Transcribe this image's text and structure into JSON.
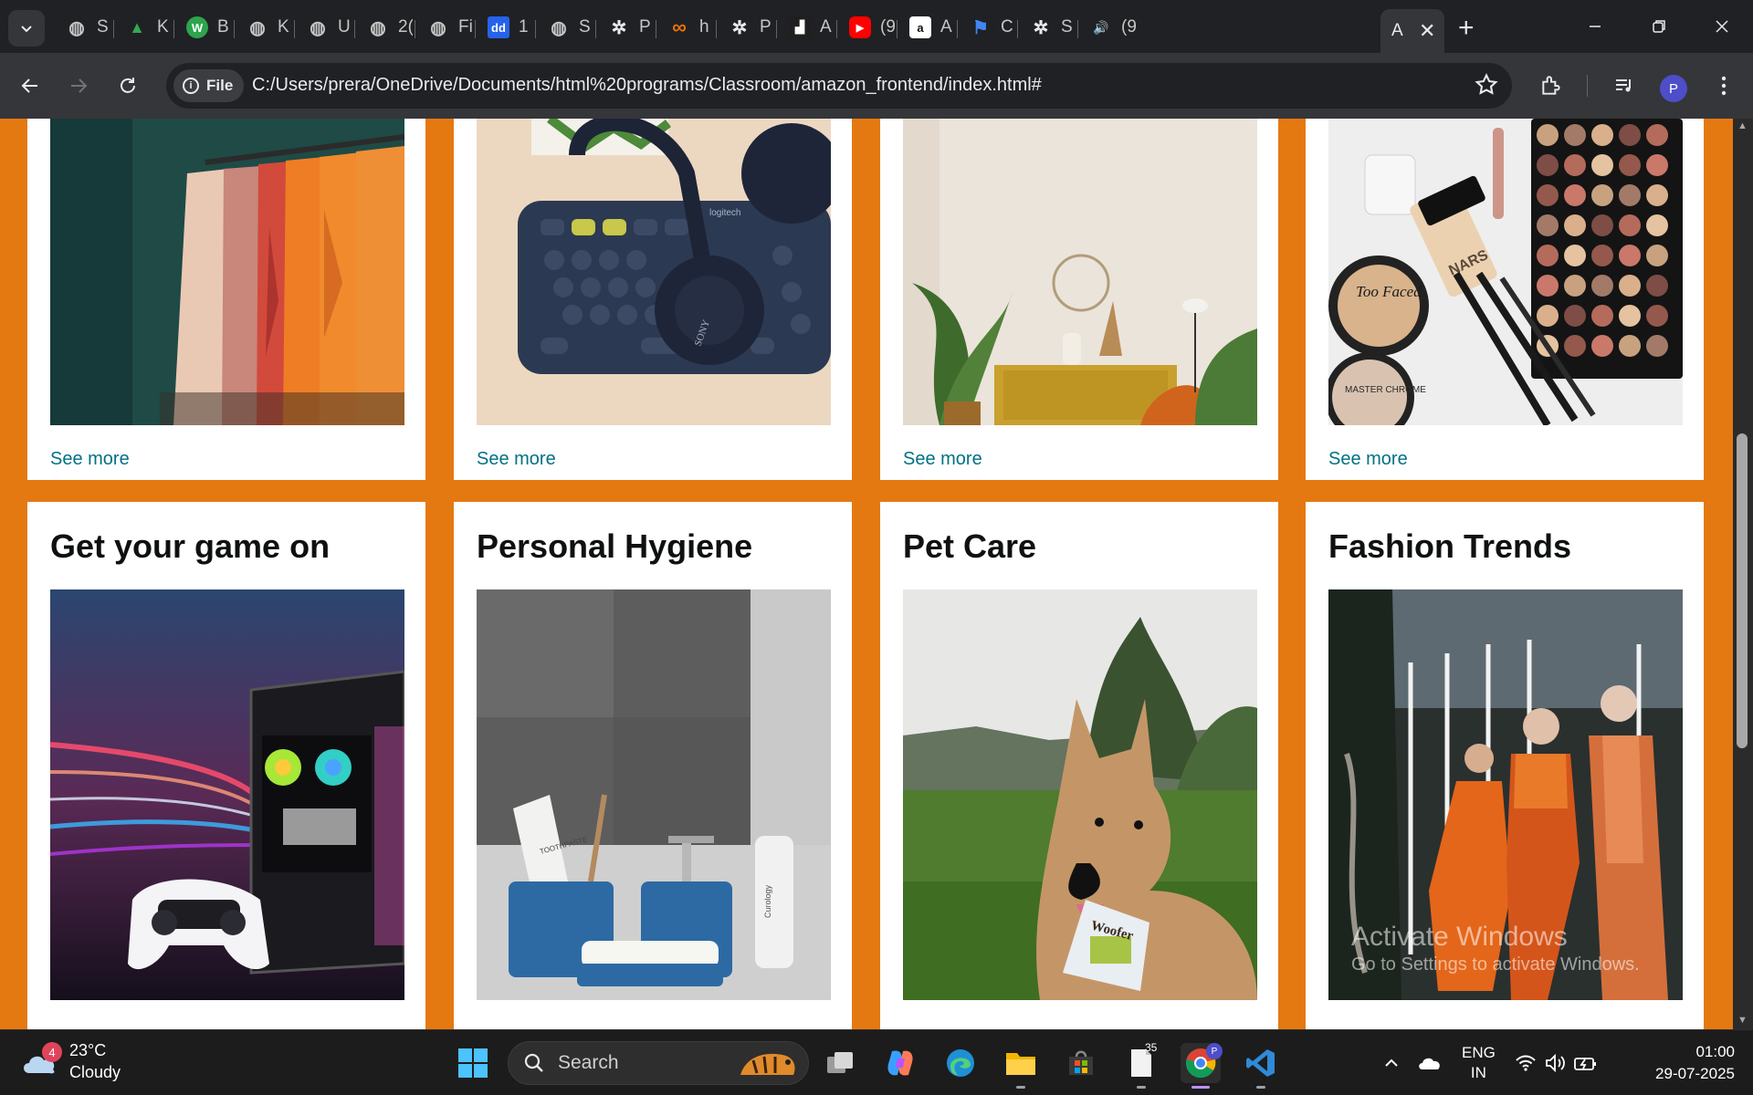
{
  "browser": {
    "tabs": [
      {
        "title": "S",
        "icon": "search-globe-icon",
        "color": "#5f6368"
      },
      {
        "title": "K",
        "icon": "drive-icon",
        "color": "#1a73e8"
      },
      {
        "title": "B",
        "icon": "w-logo-icon",
        "color": "#2da44e"
      },
      {
        "title": "K",
        "icon": "globe-icon",
        "color": "#5f6368"
      },
      {
        "title": "U",
        "icon": "globe-icon",
        "color": "#5f6368"
      },
      {
        "title": "2(",
        "icon": "globe-icon",
        "color": "#5f6368"
      },
      {
        "title": "Fi",
        "icon": "globe-icon",
        "color": "#5f6368"
      },
      {
        "title": "1",
        "icon": "dd-logo-icon",
        "color": "#2563eb"
      },
      {
        "title": "S",
        "icon": "globe-icon",
        "color": "#5f6368"
      },
      {
        "title": "P",
        "icon": "openai-icon",
        "color": "#5f6368"
      },
      {
        "title": "h",
        "icon": "infinity-icon",
        "color": "#e8710a"
      },
      {
        "title": "P",
        "icon": "openai-icon",
        "color": "#5f6368"
      },
      {
        "title": "A",
        "icon": "unstop-icon",
        "color": "#1f1f1f"
      },
      {
        "title": "(9",
        "icon": "youtube-icon",
        "color": "#ff0000"
      },
      {
        "title": "A",
        "icon": "amazon-icon",
        "color": "#ffffff"
      },
      {
        "title": "C",
        "icon": "flag-icon",
        "color": "#4285f4"
      },
      {
        "title": "S",
        "icon": "openai-icon",
        "color": "#5f6368"
      },
      {
        "title": "(9",
        "icon": "speaker-icon",
        "color": "#5f6368"
      }
    ],
    "active_tab": {
      "title": "A",
      "close": "✕"
    },
    "new_tab": "+",
    "site_chip": "File",
    "url": "C:/Users/prera/OneDrive/Documents/html%20programs/Classroom/amazon_frontend/index.html#",
    "profile_initial": "P"
  },
  "page": {
    "top_cards": [
      {
        "image": "clothes-rack-photo",
        "link": "See more"
      },
      {
        "image": "keyboard-headphones-photo",
        "link": "See more"
      },
      {
        "image": "living-room-decor-photo",
        "link": "See more"
      },
      {
        "image": "makeup-palette-photo",
        "link": "See more"
      }
    ],
    "bottom_cards": [
      {
        "title": "Get your game on",
        "image": "gaming-pc-controller-photo"
      },
      {
        "title": "Personal Hygiene",
        "image": "bathroom-toiletries-photo"
      },
      {
        "title": "Pet Care",
        "image": "dog-with-treats-photo"
      },
      {
        "title": "Fashion Trends",
        "image": "mannequins-store-window-photo"
      }
    ],
    "photo_text": {
      "keyboard_brand": "logitech",
      "headphones_brand": "SONY",
      "compact_brand": "Too Faced",
      "palette_brand": "NARS",
      "powder_brand": "MASTER CHROME",
      "toothpaste": "TOOTHPASTE",
      "bottle_brand": "Curology",
      "treat_bag": "Woofer"
    },
    "watermark": {
      "line1": "Activate Windows",
      "line2": "Go to Settings to activate Windows."
    }
  },
  "taskbar": {
    "weather_badge": "4",
    "temperature": "23°C",
    "condition": "Cloudy",
    "search_placeholder": "Search",
    "notepad_badge": "35",
    "lang_line1": "ENG",
    "lang_line2": "IN",
    "time": "01:00",
    "date": "29-07-2025"
  },
  "colors": {
    "page_background": "#e47911",
    "link": "#007185",
    "card": "#ffffff"
  }
}
